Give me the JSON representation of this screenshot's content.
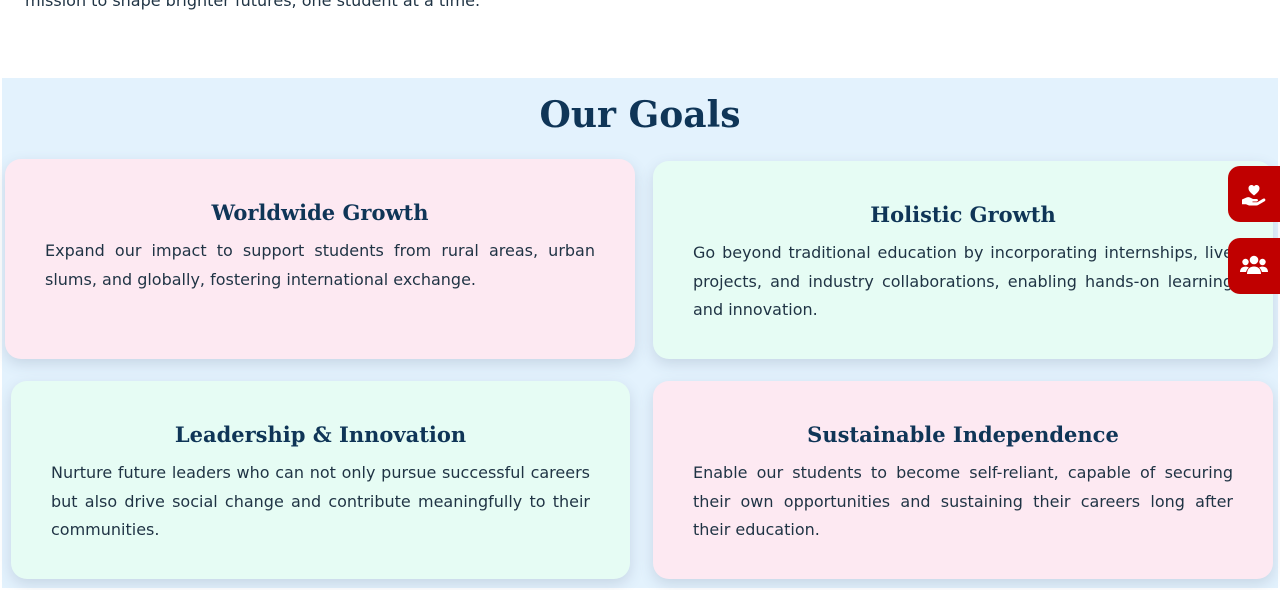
{
  "intro": {
    "tail_text": "mission to shape brighter futures, one student at a time."
  },
  "goals": {
    "title": "Our Goals",
    "cards": [
      {
        "title": "Worldwide Growth",
        "text": "Expand our impact to support students from rural areas, urban slums, and globally, fostering international exchange."
      },
      {
        "title": "Holistic Growth",
        "text": "Go beyond traditional education by incorporating internships, live projects, and industry collaborations, enabling hands-on learning and innovation."
      },
      {
        "title": "Leadership & Innovation",
        "text": "Nurture future leaders who can not only pursue successful careers but also drive social change and contribute meaningfully to their communities."
      },
      {
        "title": "Sustainable Independence",
        "text": "Enable our students to become self-reliant, capable of securing their own opportunities and sustaining their careers long after their education."
      }
    ]
  },
  "side_actions": [
    {
      "icon": "hand-holding-heart-icon"
    },
    {
      "icon": "users-group-icon"
    }
  ],
  "colors": {
    "section_bg": "#e3f2fd",
    "heading": "#0f3557",
    "card_pink": "#fde9f2",
    "card_mint": "#e6fcf4",
    "side_button": "#c00000"
  }
}
